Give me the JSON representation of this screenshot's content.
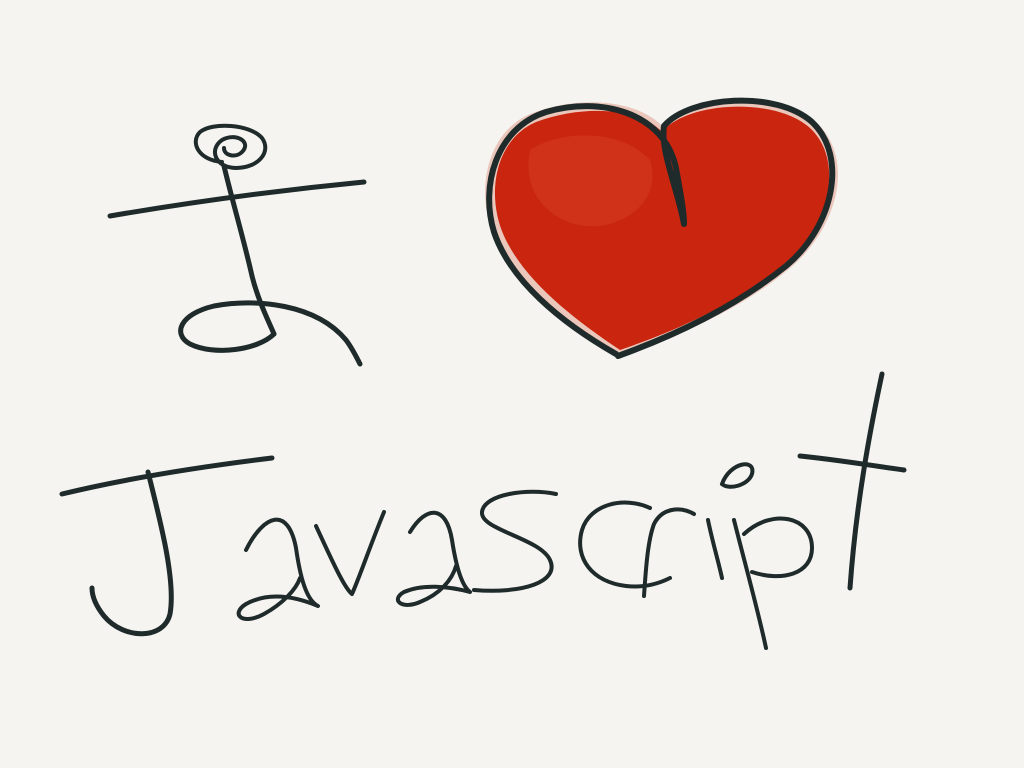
{
  "drawing": {
    "word_1": "I",
    "symbol": "heart",
    "word_2": "Javascript"
  },
  "colors": {
    "background": "#f5f4f1",
    "ink": "#1f2a2b",
    "heart_fill": "#c9250f",
    "heart_wash": "#e2a08c"
  },
  "icons": {
    "heart": "heart-icon"
  }
}
